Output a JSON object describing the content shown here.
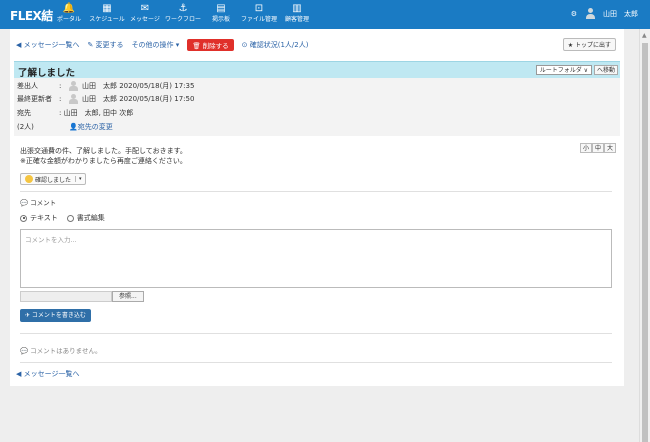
{
  "header": {
    "logo": "FLEX結",
    "nav": [
      {
        "icon": "bell-icon",
        "glyph": "🔔",
        "label": "ポータル"
      },
      {
        "icon": "calendar-icon",
        "glyph": "▦",
        "label": "スケジュール"
      },
      {
        "icon": "mail-icon",
        "glyph": "✉",
        "label": "メッセージ"
      },
      {
        "icon": "workflow-icon",
        "glyph": "⚓",
        "label": "ワークフロー"
      },
      {
        "icon": "board-icon",
        "glyph": "▤",
        "label": "掲示板"
      },
      {
        "icon": "file-icon",
        "glyph": "⊡",
        "label": "ファイル管理"
      },
      {
        "icon": "book-icon",
        "glyph": "▥",
        "label": "顧客管理"
      }
    ],
    "settings_glyph": "⚙",
    "user_name": "山田　太郎"
  },
  "toolbar": {
    "back": "◀ メッセージ一覧へ",
    "edit": "✎ 変更する",
    "other": "その他の操作 ▾",
    "delete": "🗑 削除する",
    "confirm_status": "⊙ 確認状況(1人/2人)",
    "to_top": "★ トップに出す"
  },
  "message": {
    "title": "了解しました",
    "folder_select": "ルートフォルダ ∨",
    "move_button": "へ移動",
    "sender_label": "差出人",
    "sender_value": "山田　太郎 2020/05/18(月) 17:35",
    "updater_label": "最終更新者",
    "updater_value": "山田　太郎 2020/05/18(月) 17:50",
    "recipients_label": "宛先",
    "recipients_value": "山田　太郎, 田中 次郎",
    "count_label": "(2人)",
    "change_recipients": "👤宛先の変更",
    "body_line1": "出張交通費の件、了解しました。手配しておきます。",
    "body_line2": "※正確な金額がわかりましたら再度ご連絡ください。",
    "font_small": "小",
    "font_medium": "中",
    "font_large": "大",
    "confirm_button": "確認しました",
    "confirm_caret": "▾"
  },
  "comment": {
    "header": "💬 コメント",
    "mode_text": "テキスト",
    "mode_rich": "書式編集",
    "placeholder": "コメントを入力...",
    "browse": "参照...",
    "submit": "✈ コメントを書き込む",
    "empty": "💬 コメントはありません。"
  },
  "footer": {
    "back": "◀ メッセージ一覧へ"
  }
}
